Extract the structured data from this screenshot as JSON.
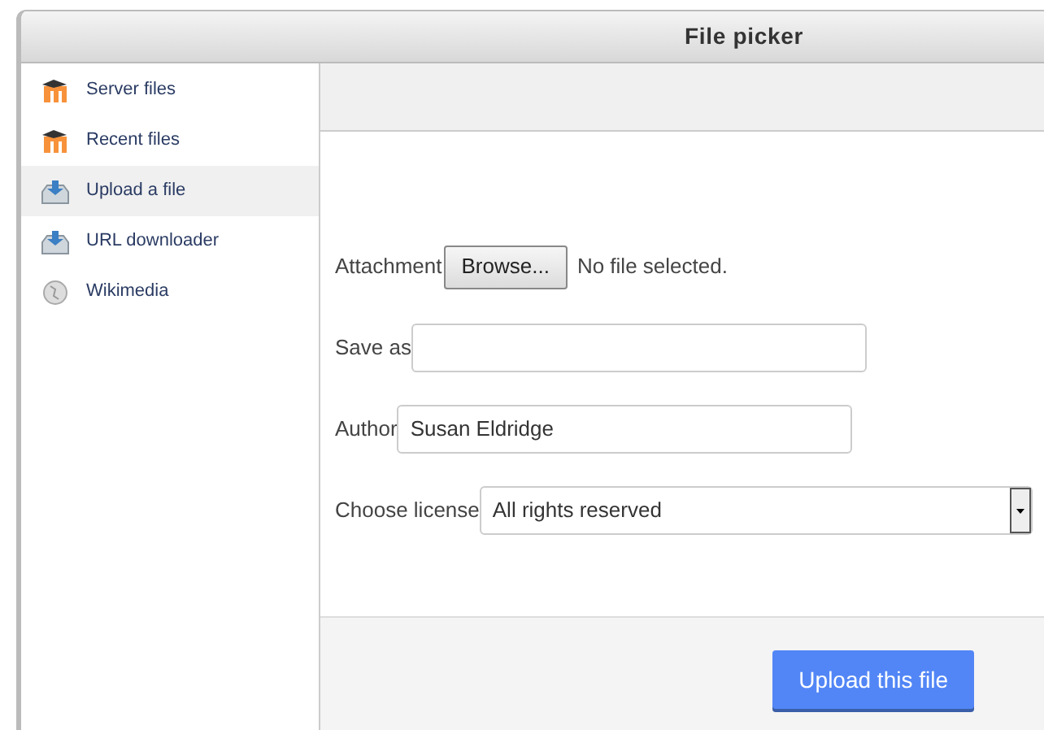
{
  "window": {
    "title": "File picker"
  },
  "sidebar": {
    "items": [
      {
        "label": "Server files",
        "kind": "moodle",
        "selected": false
      },
      {
        "label": "Recent files",
        "kind": "moodle",
        "selected": false
      },
      {
        "label": "Upload a file",
        "kind": "upload",
        "selected": true
      },
      {
        "label": "URL downloader",
        "kind": "upload",
        "selected": false
      },
      {
        "label": "Wikimedia",
        "kind": "wiki",
        "selected": false
      }
    ]
  },
  "form": {
    "attachment": {
      "label": "Attachment",
      "button": "Browse...",
      "status": "No file selected."
    },
    "save_as": {
      "label": "Save as"
    },
    "author": {
      "label": "Author",
      "value": "Susan Eldridge"
    },
    "license": {
      "label": "Choose license",
      "value": "All rights reserved"
    }
  },
  "footer": {
    "button": "Upload this file"
  }
}
